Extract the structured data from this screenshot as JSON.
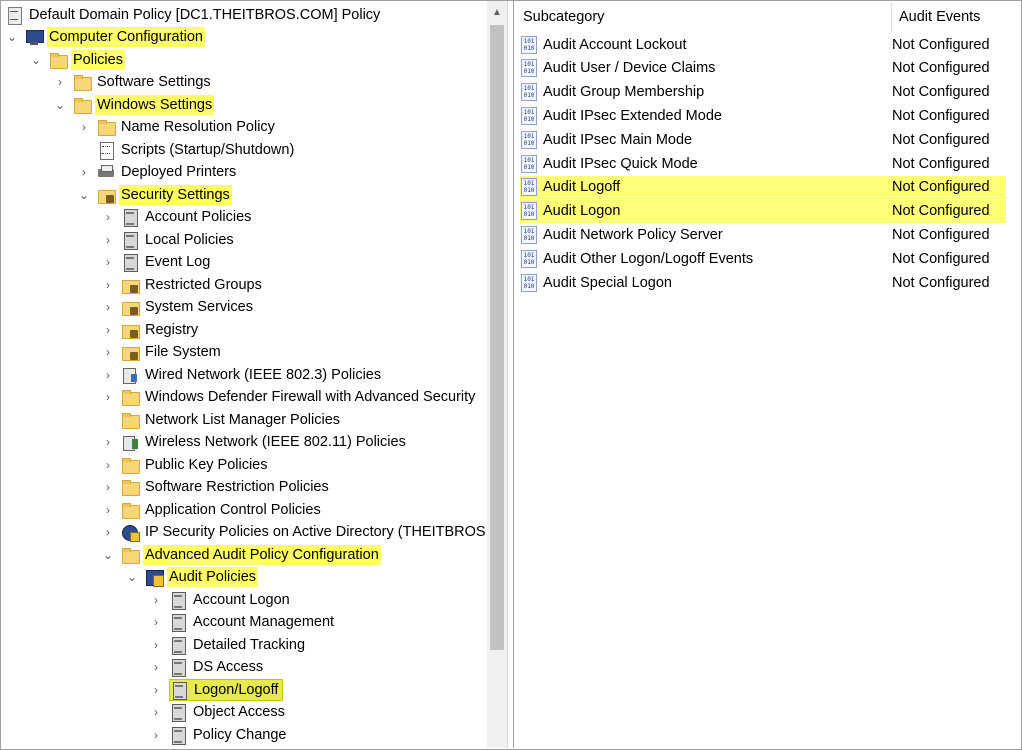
{
  "tree": {
    "root": {
      "label": "Default Domain Policy [DC1.THEITBROS.COM] Policy",
      "icon": "policy-doc-icon"
    },
    "items": [
      {
        "label": "Computer Configuration",
        "icon": "computer-icon",
        "chevron": "down",
        "highlight": true
      },
      {
        "label": "Policies",
        "icon": "folder-icon",
        "chevron": "down",
        "highlight": true
      },
      {
        "label": "Software Settings",
        "icon": "folder-icon",
        "chevron": "right",
        "highlight": false
      },
      {
        "label": "Windows Settings",
        "icon": "folder-icon",
        "chevron": "down",
        "highlight": true
      },
      {
        "label": "Name Resolution Policy",
        "icon": "folder-icon",
        "chevron": "right",
        "highlight": false
      },
      {
        "label": "Scripts (Startup/Shutdown)",
        "icon": "script-icon",
        "chevron": "none",
        "highlight": false
      },
      {
        "label": "Deployed Printers",
        "icon": "printer-icon",
        "chevron": "right",
        "highlight": false
      },
      {
        "label": "Security Settings",
        "icon": "locked-folder-icon",
        "chevron": "down",
        "highlight": true
      },
      {
        "label": "Account Policies",
        "icon": "cabinet-icon",
        "chevron": "right",
        "highlight": false
      },
      {
        "label": "Local Policies",
        "icon": "cabinet-icon",
        "chevron": "right",
        "highlight": false
      },
      {
        "label": "Event Log",
        "icon": "cabinet-icon",
        "chevron": "right",
        "highlight": false
      },
      {
        "label": "Restricted Groups",
        "icon": "locked-folder-icon",
        "chevron": "right",
        "highlight": false
      },
      {
        "label": "System Services",
        "icon": "locked-folder-icon",
        "chevron": "right",
        "highlight": false
      },
      {
        "label": "Registry",
        "icon": "locked-folder-icon",
        "chevron": "right",
        "highlight": false
      },
      {
        "label": "File System",
        "icon": "locked-folder-icon",
        "chevron": "right",
        "highlight": false
      },
      {
        "label": "Wired Network (IEEE 802.3) Policies",
        "icon": "network-icon",
        "chevron": "right",
        "highlight": false
      },
      {
        "label": "Windows Defender Firewall with Advanced Security",
        "icon": "folder-icon",
        "chevron": "right",
        "highlight": false
      },
      {
        "label": "Network List Manager Policies",
        "icon": "folder-icon",
        "chevron": "none",
        "highlight": false
      },
      {
        "label": "Wireless Network (IEEE 802.11) Policies",
        "icon": "wireless-icon",
        "chevron": "right",
        "highlight": false
      },
      {
        "label": "Public Key Policies",
        "icon": "folder-icon",
        "chevron": "right",
        "highlight": false
      },
      {
        "label": "Software Restriction Policies",
        "icon": "folder-icon",
        "chevron": "right",
        "highlight": false
      },
      {
        "label": "Application Control Policies",
        "icon": "folder-icon",
        "chevron": "right",
        "highlight": false
      },
      {
        "label": "IP Security Policies on Active Directory (THEITBROS.CO",
        "icon": "ipsec-icon",
        "chevron": "right",
        "highlight": false
      },
      {
        "label": "Advanced Audit Policy Configuration",
        "icon": "folder-icon",
        "chevron": "down",
        "highlight": true
      },
      {
        "label": "Audit Policies",
        "icon": "audit-icon",
        "chevron": "down",
        "highlight": true
      },
      {
        "label": "Account Logon",
        "icon": "cabinet-icon",
        "chevron": "right",
        "highlight": false
      },
      {
        "label": "Account Management",
        "icon": "cabinet-icon",
        "chevron": "right",
        "highlight": false
      },
      {
        "label": "Detailed Tracking",
        "icon": "cabinet-icon",
        "chevron": "right",
        "highlight": false
      },
      {
        "label": "DS Access",
        "icon": "cabinet-icon",
        "chevron": "right",
        "highlight": false
      },
      {
        "label": "Logon/Logoff",
        "icon": "cabinet-icon",
        "chevron": "right",
        "highlight": true,
        "selected": true
      },
      {
        "label": "Object Access",
        "icon": "cabinet-icon",
        "chevron": "right",
        "highlight": false
      },
      {
        "label": "Policy Change",
        "icon": "cabinet-icon",
        "chevron": "right",
        "highlight": false
      }
    ]
  },
  "details": {
    "columns": {
      "subcategory": "Subcategory",
      "audit_events": "Audit Events"
    },
    "rows": [
      {
        "name": "Audit Account Lockout",
        "value": "Not Configured",
        "highlight": false
      },
      {
        "name": "Audit User / Device Claims",
        "value": "Not Configured",
        "highlight": false
      },
      {
        "name": "Audit Group Membership",
        "value": "Not Configured",
        "highlight": false
      },
      {
        "name": "Audit IPsec Extended Mode",
        "value": "Not Configured",
        "highlight": false
      },
      {
        "name": "Audit IPsec Main Mode",
        "value": "Not Configured",
        "highlight": false
      },
      {
        "name": "Audit IPsec Quick Mode",
        "value": "Not Configured",
        "highlight": false
      },
      {
        "name": "Audit Logoff",
        "value": "Not Configured",
        "highlight": true
      },
      {
        "name": "Audit Logon",
        "value": "Not Configured",
        "highlight": true
      },
      {
        "name": "Audit Network Policy Server",
        "value": "Not Configured",
        "highlight": false
      },
      {
        "name": "Audit Other Logon/Logoff Events",
        "value": "Not Configured",
        "highlight": false
      },
      {
        "name": "Audit Special Logon",
        "value": "Not Configured",
        "highlight": false
      }
    ]
  },
  "colors": {
    "highlight": "#ffff66",
    "selected": "#e6ea4a",
    "folder": "#f7d774"
  }
}
